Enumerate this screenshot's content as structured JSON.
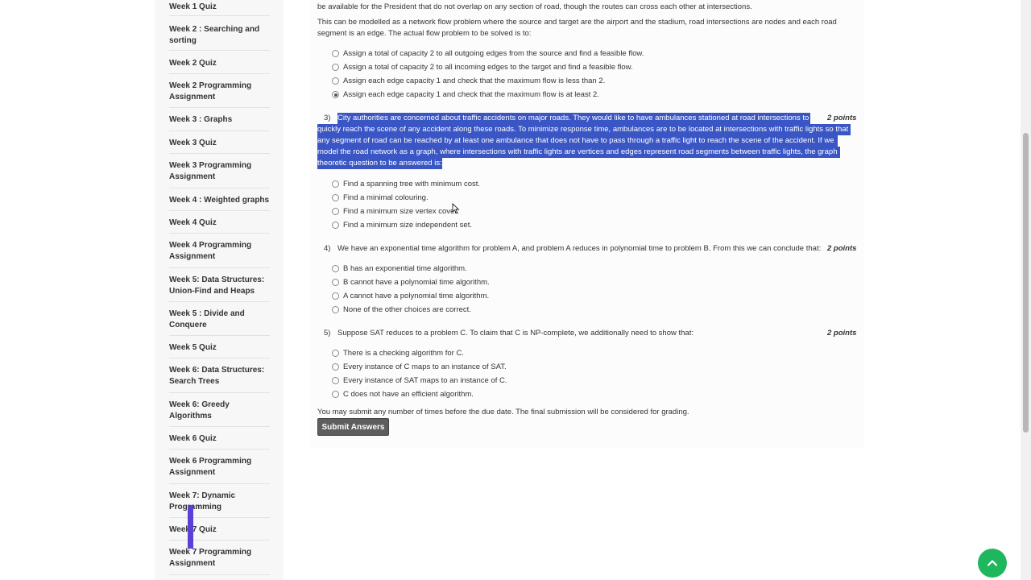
{
  "sidebar": {
    "items": [
      {
        "label": "Week 1 Quiz"
      },
      {
        "label": "Week 2 : Searching and sorting"
      },
      {
        "label": "Week 2 Quiz"
      },
      {
        "label": "Week 2 Programming Assignment"
      },
      {
        "label": "Week 3 : Graphs"
      },
      {
        "label": "Week 3 Quiz"
      },
      {
        "label": "Week 3 Programming Assignment"
      },
      {
        "label": "Week 4 : Weighted graphs"
      },
      {
        "label": "Week 4 Quiz"
      },
      {
        "label": "Week 4 Programming Assignment"
      },
      {
        "label": "Week 5: Data Structures: Union-Find and Heaps"
      },
      {
        "label": "Week 5 : Divide and Conquere"
      },
      {
        "label": "Week 5 Quiz"
      },
      {
        "label": "Week 6: Data Structures: Search Trees"
      },
      {
        "label": "Week 6: Greedy Algorithms"
      },
      {
        "label": "Week 6 Quiz"
      },
      {
        "label": "Week 6 Programming Assignment"
      },
      {
        "label": "Week 7: Dynamic Programming"
      },
      {
        "label": "Week 7 Quiz"
      },
      {
        "label": "Week 7 Programming Assignment"
      }
    ]
  },
  "q2": {
    "text_line1": "be available for the President that do not overlap on any section of road, though the routes can cross each other at intersections.",
    "text_line2": "This can be modelled as a network flow problem where the source and target are the airport and the stadium, road intersections are nodes and each road",
    "text_line3": "segment is an edge. The actual flow problem to be solved is to:",
    "options": [
      {
        "label": "Assign a total of capacity 2 to all outgoing edges from the source and find a feasible flow.",
        "checked": false
      },
      {
        "label": "Assign a total of capacity 2 to all incoming edges to the target and find a feasible flow.",
        "checked": false
      },
      {
        "label": "Assign each edge capacity 1 and check that the maximum flow is less than 2.",
        "checked": false
      },
      {
        "label": "Assign each edge capacity 1 and check that the maximum flow is at least 2.",
        "checked": true
      }
    ]
  },
  "q3": {
    "number": "3)",
    "points": "2 points",
    "lines": [
      "City authorities are concerned about traffic accidents on major roads. They would like to have ambulances stationed at road intersections to",
      "quickly reach the scene of any accident along these roads. To minimize response time, ambulances are to be located at intersections with traffic lights so that",
      "any segment of road can be reached by at least one ambulance that does not have to pass through a traffic light to reach the scene of the accident. If we",
      "model the road network as a graph, where intersections with traffic lights are vertices and edges represent road segments between traffic lights, the graph",
      "theoretic question to be answered is:"
    ],
    "options": [
      {
        "label": "Find a spanning tree with minimum cost."
      },
      {
        "label": "Find a minimal colouring."
      },
      {
        "label": "Find a minimum size vertex cover."
      },
      {
        "label": "Find a minimum size independent set."
      }
    ]
  },
  "q4": {
    "number": "4)",
    "points": "2 points",
    "text": "We have an exponential time algorithm for problem A, and problem A reduces in polynomial time to problem B. From this we can conclude that:",
    "options": [
      {
        "label": "B has an exponential time algorithm."
      },
      {
        "label": "B cannot have a polynomial time algorithm."
      },
      {
        "label": "A cannot have a polynomial time algorithm."
      },
      {
        "label": "None of the other choices are correct."
      }
    ]
  },
  "q5": {
    "number": "5)",
    "points": "2 points",
    "text": "Suppose SAT reduces to a problem C. To claim that C is NP-complete, we additionally need to show that:",
    "options": [
      {
        "label": "There is a checking algorithm for C."
      },
      {
        "label": "Every instance of C maps to an instance of SAT."
      },
      {
        "label": "Every instance of SAT maps to an instance of C."
      },
      {
        "label": "C does not have an efficient algorithm."
      }
    ]
  },
  "footer": {
    "note": "You may submit any number of times before the due date. The final submission will be considered for grading.",
    "submit_label": "Submit Answers"
  },
  "colors": {
    "highlight": "#3a56c5",
    "fab": "#1fb75e",
    "submit": "#5e5e5e"
  },
  "icons": {
    "fab": "chevron-up-icon",
    "cursor": "mouse-pointer-icon"
  }
}
